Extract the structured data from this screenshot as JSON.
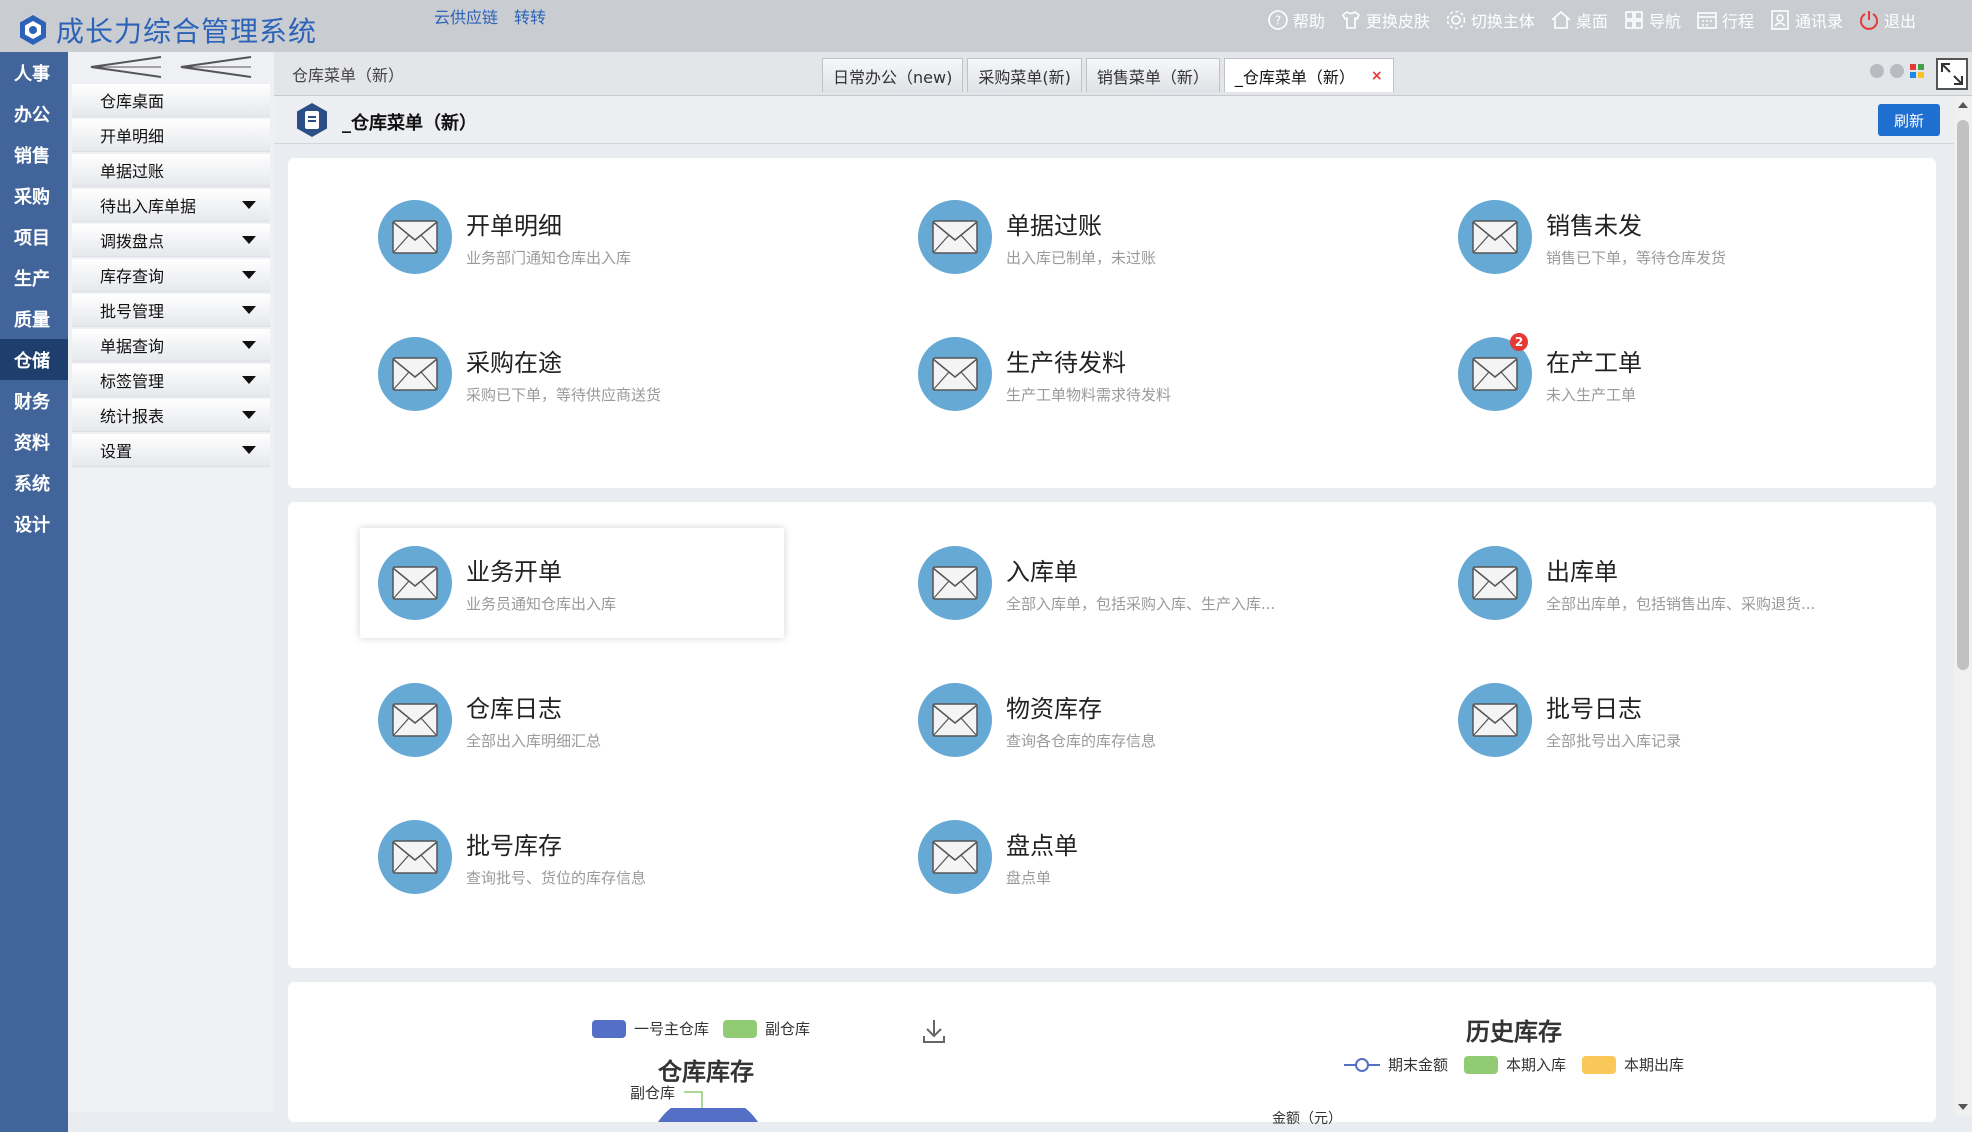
{
  "app": {
    "title": "成长力综合管理系统",
    "links": [
      "云供应链",
      "转转"
    ]
  },
  "topnav": [
    {
      "label": "帮助",
      "icon": "help-icon"
    },
    {
      "label": "更换皮肤",
      "icon": "shirt-icon"
    },
    {
      "label": "切换主体",
      "icon": "gear-icon"
    },
    {
      "label": "桌面",
      "icon": "home-icon"
    },
    {
      "label": "导航",
      "icon": "grid-icon"
    },
    {
      "label": "行程",
      "icon": "calendar-icon"
    },
    {
      "label": "通讯录",
      "icon": "contacts-icon"
    },
    {
      "label": "退出",
      "icon": "power-icon"
    }
  ],
  "rail": [
    "人事",
    "办公",
    "销售",
    "采购",
    "项目",
    "生产",
    "质量",
    "仓储",
    "财务",
    "资料",
    "系统",
    "设计"
  ],
  "rail_active": 7,
  "submenu": [
    {
      "label": "仓库桌面",
      "caret": false
    },
    {
      "label": "开单明细",
      "caret": false
    },
    {
      "label": "单据过账",
      "caret": false
    },
    {
      "label": "待出入库单据",
      "caret": true
    },
    {
      "label": "调拨盘点",
      "caret": true
    },
    {
      "label": "库存查询",
      "caret": true
    },
    {
      "label": "批号管理",
      "caret": true
    },
    {
      "label": "单据查询",
      "caret": true
    },
    {
      "label": "标签管理",
      "caret": true
    },
    {
      "label": "统计报表",
      "caret": true
    },
    {
      "label": "设置",
      "caret": true
    }
  ],
  "breadcrumb": "仓库菜单（新）",
  "tabs": [
    {
      "label": "日常办公（new)"
    },
    {
      "label": "采购菜单(新)"
    },
    {
      "label": "销售菜单（新）"
    },
    {
      "label": "_仓库菜单（新）",
      "active": true,
      "close": "×"
    }
  ],
  "page": {
    "title": "_仓库菜单（新）",
    "refresh": "刷新"
  },
  "cards_top": [
    {
      "title": "开单明细",
      "desc": "业务部门通知仓库出入库"
    },
    {
      "title": "单据过账",
      "desc": "出入库已制单，未过账"
    },
    {
      "title": "销售未发",
      "desc": "销售已下单，等待仓库发货"
    },
    {
      "title": "采购在途",
      "desc": "采购已下单，等待供应商送货"
    },
    {
      "title": "生产待发料",
      "desc": "生产工单物料需求待发料"
    },
    {
      "title": "在产工单",
      "desc": "未入生产工单",
      "badge": "2"
    }
  ],
  "cards_bottom": [
    {
      "title": "业务开单",
      "desc": "业务员通知仓库出入库"
    },
    {
      "title": "入库单",
      "desc": "全部入库单，包括采购入库、生产入库..."
    },
    {
      "title": "出库单",
      "desc": "全部出库单，包括销售出库、采购退货..."
    },
    {
      "title": "仓库日志",
      "desc": "全部出入库明细汇总"
    },
    {
      "title": "物资库存",
      "desc": "查询各仓库的库存信息"
    },
    {
      "title": "批号日志",
      "desc": "全部批号出入库记录"
    },
    {
      "title": "批号库存",
      "desc": "查询批号、货位的库存信息"
    },
    {
      "title": "盘点单",
      "desc": "盘点单"
    }
  ],
  "charts": {
    "left": {
      "title": "仓库库存",
      "legend": [
        {
          "name": "一号主仓库",
          "color": "#5470c6"
        },
        {
          "name": "副仓库",
          "color": "#91cc75"
        }
      ],
      "slice_label": "副仓库"
    },
    "right": {
      "title": "历史库存",
      "legend": [
        {
          "name": "期末金额",
          "color": "#5470c6"
        },
        {
          "name": "本期入库",
          "color": "#91cc75"
        },
        {
          "name": "本期出库",
          "color": "#fac858"
        }
      ],
      "ylabel": "金额（元）"
    }
  },
  "colors": {
    "brand": "#2c63b8",
    "rail": "#41659b",
    "rail_active": "#1e3f6d",
    "icon_circle": "#67a9d5",
    "button": "#1f6fd1"
  }
}
